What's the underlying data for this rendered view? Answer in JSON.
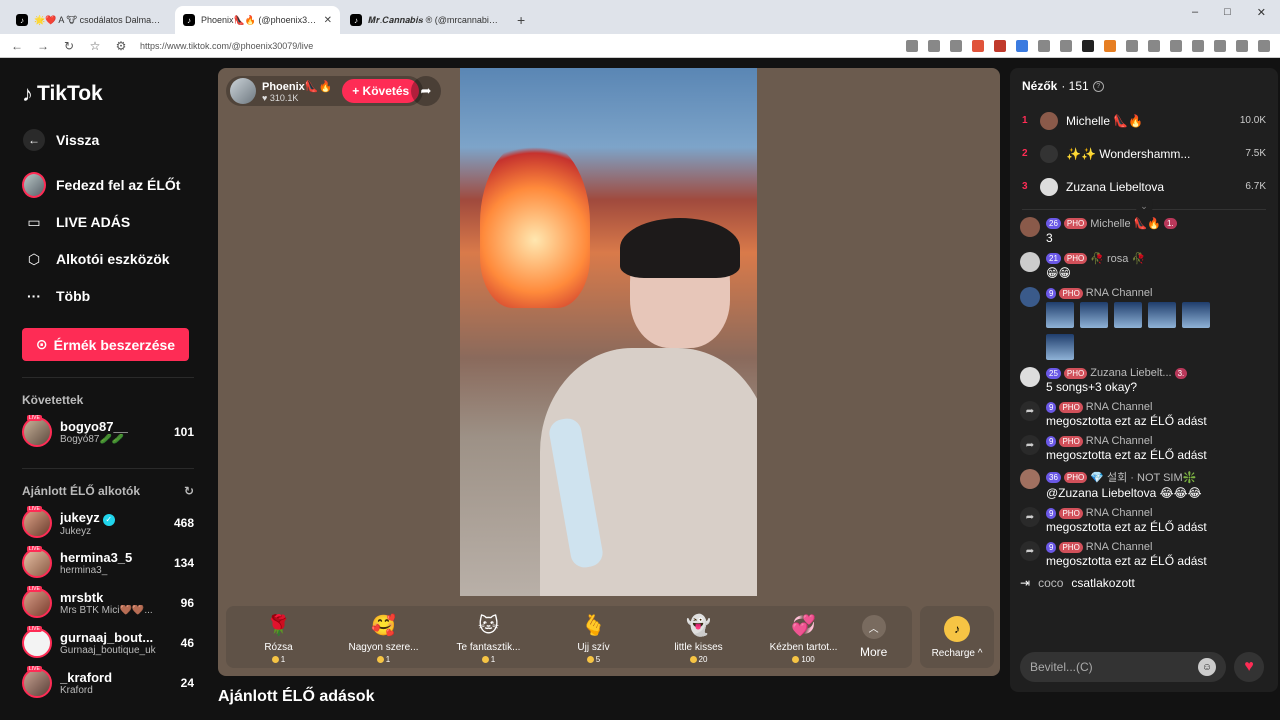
{
  "browser": {
    "tabs": [
      {
        "title": "🌟❤️ A 🐮 csodálatos Dalma🧝 (@..."
      },
      {
        "title": "Phoenix👠🔥 (@phoenix30079)"
      },
      {
        "title": "𝑴𝒓.𝑪𝒂𝒏𝒏𝒂𝒃𝒊𝒔 ® (@mrcannabis_)"
      }
    ],
    "url": "https://www.tiktok.com/@phoenix30079/live",
    "new_tab": "+"
  },
  "sidebar": {
    "brand": "TikTok",
    "nav": [
      {
        "label": "Vissza"
      },
      {
        "label": "Fedezd fel az ÉLŐt"
      },
      {
        "label": "LIVE ADÁS"
      },
      {
        "label": "Alkotói eszközök"
      },
      {
        "label": "Több"
      }
    ],
    "coins_button": "Érmék beszerzése",
    "following_title": "Követettek",
    "following": [
      {
        "name": "bogyo87__",
        "sub": "Bogyó87🥒🥒",
        "count": "101"
      }
    ],
    "recommended_title": "Ajánlott ÉLŐ alkotók",
    "recommended": [
      {
        "name": "jukeyz",
        "sub": "Jukeyz",
        "count": "468",
        "verified": true
      },
      {
        "name": "hermina3_5",
        "sub": "hermina3_",
        "count": "134"
      },
      {
        "name": "mrsbtk",
        "sub": "Mrs BTK Mici🤎🤎...",
        "count": "96"
      },
      {
        "name": "gurnaaj_bout...",
        "sub": "Gurnaaj_boutique_uk",
        "count": "46"
      },
      {
        "name": "_kraford",
        "sub": "Kraford",
        "count": "24"
      }
    ],
    "live_badge": "LIVE"
  },
  "stream": {
    "streamer_name": "Phoenix👠🔥",
    "likes": "♥ 310.1K",
    "follow_label": "+ Követés",
    "gifts": [
      {
        "name": "Rózsa",
        "price": "1",
        "icon": "rose-icon",
        "emoji": "🌹"
      },
      {
        "name": "Nagyon szere...",
        "price": "1",
        "icon": "heart-face-icon",
        "emoji": "🥰"
      },
      {
        "name": "Te fantasztik...",
        "price": "1",
        "icon": "cat-icon",
        "emoji": "🐱"
      },
      {
        "name": "Ujj szív",
        "price": "5",
        "icon": "finger-heart-icon",
        "emoji": "🫰"
      },
      {
        "name": "little kisses",
        "price": "20",
        "icon": "ghost-icon",
        "emoji": "👻"
      },
      {
        "name": "Kézben tartot...",
        "price": "100",
        "icon": "hearts-icon",
        "emoji": "💞"
      }
    ],
    "more_label": "More",
    "recharge_label": "Recharge ^",
    "recommended_lives_title": "Ajánlott ÉLŐ adások"
  },
  "chat": {
    "viewers_label": "Nézők",
    "viewers_count": "· 151",
    "top_viewers": [
      {
        "rank": "1",
        "name": "Michelle 👠🔥",
        "score": "10.0K"
      },
      {
        "rank": "2",
        "name": "✨✨ Wondershamm...",
        "score": "7.5K"
      },
      {
        "rank": "3",
        "name": "Zuzana Liebeltova",
        "score": "6.7K"
      }
    ],
    "messages": [
      {
        "level": "26",
        "fan": "PHO",
        "user": "Michelle 👠🔥",
        "rank": "1.",
        "text": "3"
      },
      {
        "level": "21",
        "fan": "PHO",
        "user": "🥀 rosa 🥀",
        "text": "😁😁"
      },
      {
        "level": "9",
        "fan": "PHO",
        "user": "RNA Channel",
        "text": ""
      },
      {
        "level": "25",
        "fan": "PHO",
        "user": "Zuzana Liebelt...",
        "rank": "3.",
        "text": "5 songs+3 okay?"
      },
      {
        "level": "9",
        "fan": "PHO",
        "user": "RNA Channel",
        "text": "megosztotta ezt az ÉLŐ adást"
      },
      {
        "level": "9",
        "fan": "PHO",
        "user": "RNA Channel",
        "text": "megosztotta ezt az ÉLŐ adást"
      },
      {
        "level": "36",
        "fan": "PHO",
        "user": "💎 설회 · NOT SIM❇️",
        "text": "@Zuzana Liebeltova 😂😂😂"
      },
      {
        "level": "9",
        "fan": "PHO",
        "user": "RNA Channel",
        "text": "megosztotta ezt az ÉLŐ adást"
      },
      {
        "level": "9",
        "fan": "PHO",
        "user": "RNA Channel",
        "text": "megosztotta ezt az ÉLŐ adást"
      }
    ],
    "joined_user": "coco",
    "joined_text": "csatlakozott",
    "input_placeholder": "Bevitel...(C)"
  },
  "colors": {
    "accent": "#fe2c55",
    "stage_bg": "#6b5b4e",
    "panel_bg": "#1f1f1f"
  }
}
